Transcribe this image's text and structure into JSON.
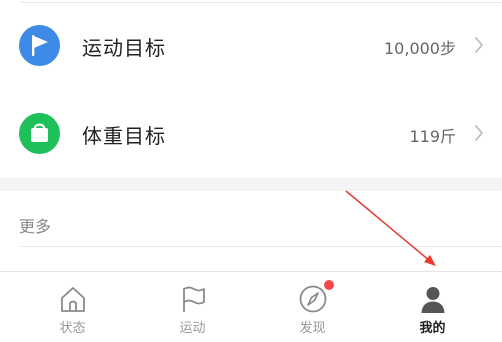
{
  "goals": [
    {
      "label": "运动目标",
      "value": "10,000步",
      "icon": "flag-icon",
      "color": "#3d8ae7"
    },
    {
      "label": "体重目标",
      "value": "119斤",
      "icon": "scale-bag-icon",
      "color": "#1ec05a"
    }
  ],
  "more": {
    "label": "更多"
  },
  "tabs": [
    {
      "label": "状态",
      "icon": "home-icon",
      "active": false
    },
    {
      "label": "运动",
      "icon": "flag-outline-icon",
      "active": false
    },
    {
      "label": "发现",
      "icon": "compass-icon",
      "active": false,
      "badge": true
    },
    {
      "label": "我的",
      "icon": "person-icon",
      "active": true
    }
  ],
  "colors": {
    "annotation_arrow": "#e8382f",
    "badge": "#f4474b",
    "active_tab": "#222222"
  }
}
